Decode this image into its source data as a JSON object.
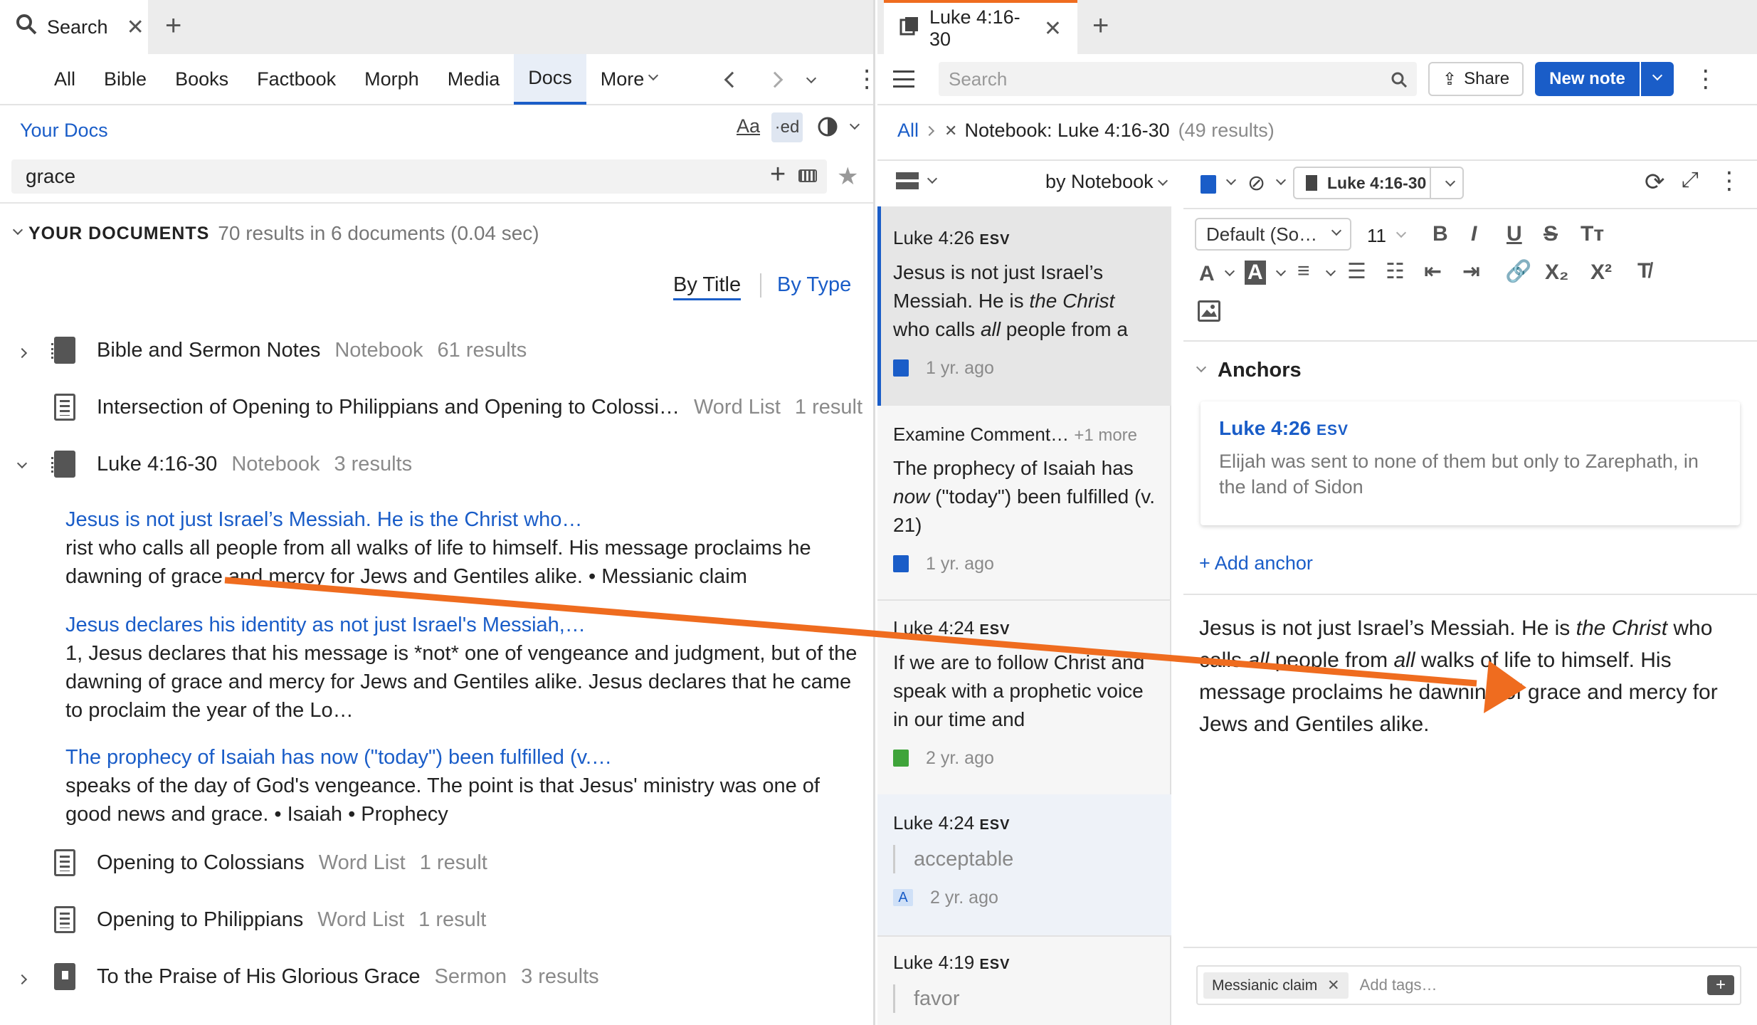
{
  "left": {
    "tab": {
      "label": "Search"
    },
    "nav": {
      "items": [
        "All",
        "Bible",
        "Books",
        "Factbook",
        "Morph",
        "Media",
        "Docs"
      ],
      "active": "Docs",
      "more": "More"
    },
    "scope_label": "Your Docs",
    "search_value": "grace",
    "results": {
      "header": "YOUR DOCUMENTS",
      "summary": "70 results in 6 documents (0.04 sec)"
    },
    "sort": {
      "by_title": "By Title",
      "by_type": "By Type"
    },
    "docs": [
      {
        "title": "Bible and Sermon Notes",
        "type": "Notebook",
        "count": "61 results"
      },
      {
        "title": "Intersection of Opening to Philippians and Opening to Colossi…",
        "type": "Word List",
        "count": "1 result"
      },
      {
        "title": "Luke 4:16-30",
        "type": "Notebook",
        "count": "3 results"
      },
      {
        "title": "Opening to Colossians",
        "type": "Word List",
        "count": "1 result"
      },
      {
        "title": "Opening to Philippians",
        "type": "Word List",
        "count": "1 result"
      },
      {
        "title": "To the Praise of His Glorious Grace",
        "type": "Sermon",
        "count": "3 results"
      }
    ],
    "hits": [
      {
        "title": "Jesus is not just Israel’s Messiah. He is the Christ who…",
        "text": "rist who calls all people from all walks of life to himself. His message proclaims he dawning of grace and mercy for Jews and Gentiles alike.  • Messianic claim"
      },
      {
        "title": "Jesus declares his identity as not just Israel's Messiah,…",
        "text": "1, Jesus declares that his message is *not* one of vengeance and judgment, but of the dawning of grace and mercy for Jews and Gentiles alike. Jesus declares that he came to proclaim the year of the Lo…"
      },
      {
        "title": "The prophecy of Isaiah has now (\"today\") been fulfilled (v.…",
        "text": "speaks of the day of God's vengeance. The point is that Jesus' ministry was one of good news and grace.  • Isaiah • Prophecy"
      }
    ]
  },
  "right": {
    "tab": {
      "label": "Luke 4:16-30"
    },
    "search_placeholder": "Search",
    "share_label": "Share",
    "new_note_label": "New note",
    "breadcrumb": {
      "all": "All",
      "filter": "Notebook: Luke 4:16-30",
      "count": "(49 results)"
    },
    "group_label": "by Notebook",
    "notebook_label": "Luke 4:16-30",
    "font_select": "Default (So…",
    "size_select": "11",
    "notes": [
      {
        "ref": "Luke 4:26",
        "ver": "ESV",
        "text_a": "Jesus is not just Israel’s Messiah. He is ",
        "text_b": "the Christ",
        "text_c": " who calls ",
        "text_d": "all",
        "text_e": " people from a",
        "when": "1 yr. ago"
      },
      {
        "ref": "Examine Comment…",
        "extra": "+1 more",
        "text_a": "The prophecy of Isaiah has ",
        "text_b": "now",
        "text_c": " (\"today\") been fulfilled (v. 21)",
        "when": "1 yr. ago"
      },
      {
        "ref": "Luke 4:24",
        "ver": "ESV",
        "text_a": "If we are to follow Christ and speak with a prophetic voice in our time and",
        "when": "2 yr. ago"
      },
      {
        "ref": "Luke 4:24",
        "ver": "ESV",
        "quote": "acceptable",
        "when": "2 yr. ago"
      },
      {
        "ref": "Luke 4:19",
        "ver": "ESV",
        "quote": "favor"
      }
    ],
    "anchors": {
      "heading": "Anchors",
      "card_ref": "Luke 4:26",
      "card_ver": "ESV",
      "card_text": "Elijah was sent to none of them but only to Zarephath, in the land of Sidon",
      "add": "+ Add anchor"
    },
    "body": {
      "p1": "Jesus is not just Israel’s Messiah. He is ",
      "p2": "the Christ",
      "p3": " who calls ",
      "p4": "all",
      "p5": " people from ",
      "p6": "all",
      "p7": " walks of life to himself. His message proclaims he dawning of grace and mercy for Jews and Gentiles alike."
    },
    "tags": {
      "tag": "Messianic claim",
      "placeholder": "Add tags…"
    }
  },
  "colors": {
    "accent": "#1a5dc8",
    "arrow": "#ef6c1f",
    "tab_underline": "#ef6c1f"
  }
}
